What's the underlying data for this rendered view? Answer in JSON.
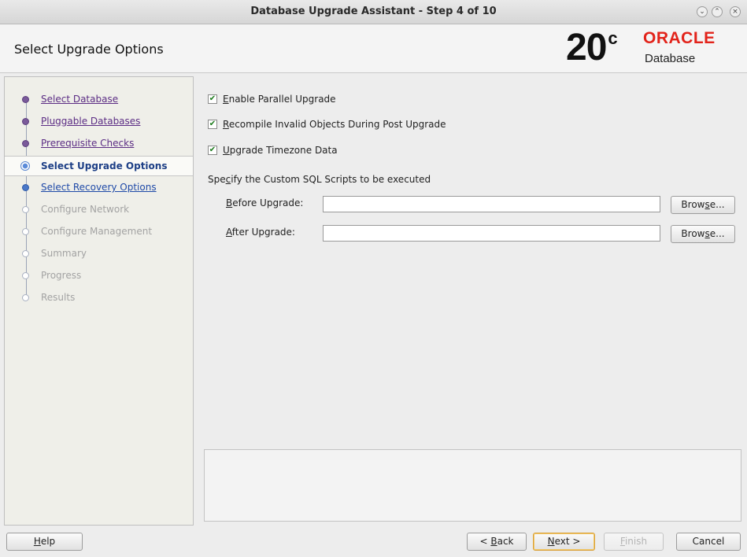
{
  "window": {
    "title": "Database Upgrade Assistant - Step 4 of 10",
    "controls": [
      "minimize",
      "maximize",
      "close"
    ]
  },
  "header": {
    "page_title": "Select Upgrade Options",
    "logo": {
      "version": "20",
      "version_suffix": "c",
      "brand": "ORACLE",
      "product": "Database",
      "brand_color": "#e2231a"
    }
  },
  "nav": {
    "items": [
      {
        "label": "Select Database",
        "state": "done"
      },
      {
        "label": "Pluggable Databases",
        "state": "done"
      },
      {
        "label": "Prerequisite Checks",
        "state": "done"
      },
      {
        "label": "Select Upgrade Options",
        "state": "current"
      },
      {
        "label": "Select Recovery Options",
        "state": "visited"
      },
      {
        "label": "Configure Network",
        "state": "future"
      },
      {
        "label": "Configure Management",
        "state": "future"
      },
      {
        "label": "Summary",
        "state": "future"
      },
      {
        "label": "Progress",
        "state": "future"
      },
      {
        "label": "Results",
        "state": "future"
      }
    ]
  },
  "options": {
    "parallel": {
      "mnemonic": "E",
      "rest": "nable Parallel Upgrade",
      "checked": true
    },
    "recompile": {
      "mnemonic": "R",
      "rest": "ecompile Invalid Objects During Post Upgrade",
      "checked": true
    },
    "timezone": {
      "mnemonic": "U",
      "rest": "pgrade Timezone Data",
      "checked": true
    }
  },
  "scripts": {
    "section_pre": "Spe",
    "section_mnemonic": "c",
    "section_post": "ify the Custom SQL Scripts to be executed",
    "before": {
      "mnemonic": "B",
      "rest": "efore Upgrade:",
      "value": ""
    },
    "after": {
      "mnemonic": "A",
      "rest": "fter Upgrade:",
      "value": ""
    },
    "browse_pre": "Brow",
    "browse_mnemonic": "s",
    "browse_post": "e..."
  },
  "footer": {
    "help": {
      "mnemonic": "H",
      "rest": "elp"
    },
    "back": {
      "pre": "< ",
      "mnemonic": "B",
      "rest": "ack"
    },
    "next": {
      "mnemonic": "N",
      "rest": "ext >"
    },
    "finish": {
      "mnemonic": "F",
      "rest": "inish",
      "enabled": false
    },
    "cancel": "Cancel"
  }
}
